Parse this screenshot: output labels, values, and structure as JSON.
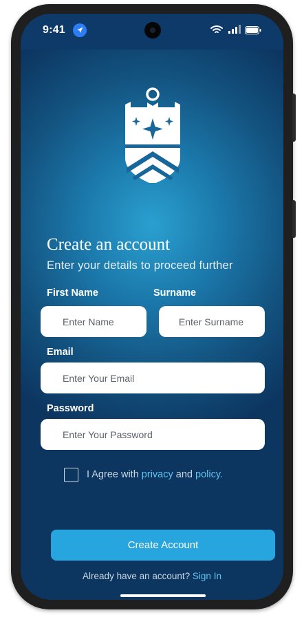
{
  "status_bar": {
    "time": "9:41",
    "icons": [
      "location-arrow-icon",
      "wifi-icon",
      "cellular-signal-icon",
      "battery-icon"
    ]
  },
  "logo": {
    "icon": "shield-crest-icon"
  },
  "form": {
    "title": "Create an account",
    "subtitle": "Enter your details to proceed further",
    "first_name": {
      "label": "First Name",
      "placeholder": "Enter Name",
      "value": ""
    },
    "surname": {
      "label": "Surname",
      "placeholder": "Enter Surname",
      "value": ""
    },
    "email": {
      "label": "Email",
      "placeholder": "Enter Your Email",
      "value": ""
    },
    "password": {
      "label": "Password",
      "placeholder": "Enter Your Password",
      "value": ""
    },
    "agreement": {
      "checked": false,
      "prefix": "I Agree with",
      "privacy_link": "privacy",
      "and": "and",
      "policy_link": "policy."
    },
    "submit_label": "Create Account",
    "signin_prompt": "Already have an account?",
    "signin_link": "Sign In"
  },
  "colors": {
    "background_dark": "#0c3560",
    "background_glow": "#2aa0d0",
    "accent_button": "#26a5de",
    "link": "#5fc3f0",
    "field_bg": "#ffffff"
  }
}
